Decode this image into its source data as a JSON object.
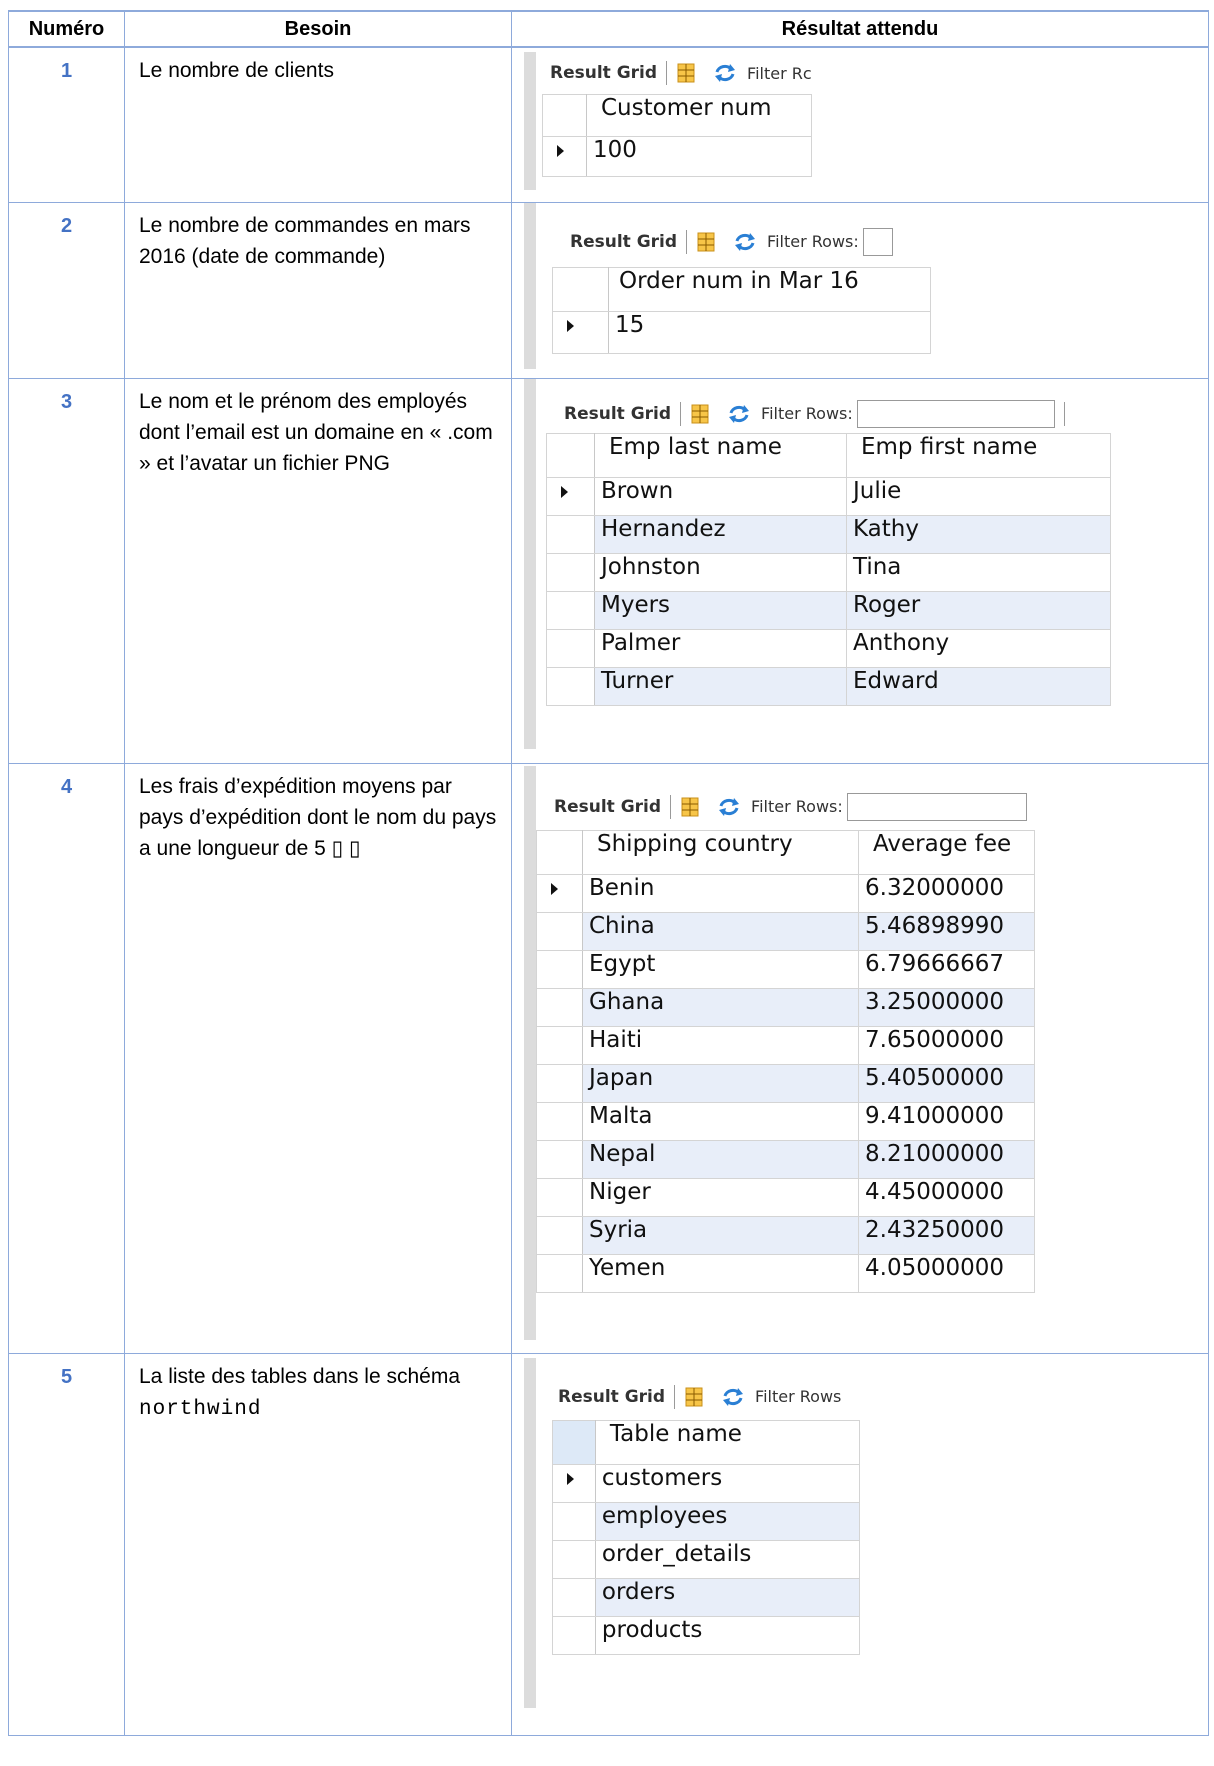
{
  "headers": {
    "num": "Numéro",
    "need": "Besoin",
    "result": "Résultat attendu"
  },
  "grid_toolbar": {
    "tab": "Result Grid",
    "filter_full": "Filter Rows:",
    "filter_cut_1": "Filter Rc",
    "filter_cut_5": "Filter Rows"
  },
  "rows": [
    {
      "num": "1",
      "need": "Le nombre de clients",
      "grid": {
        "columns": [
          "Customer num"
        ],
        "rows": [
          [
            "100"
          ]
        ]
      }
    },
    {
      "num": "2",
      "need": "Le nombre de commandes en mars 2016 (date de commande)",
      "grid": {
        "columns": [
          "Order num in Mar 16"
        ],
        "rows": [
          [
            "15"
          ]
        ]
      }
    },
    {
      "num": "3",
      "need": "Le nom et le prénom des employés dont l’email est un domaine en « .com » et l’avatar un fichier PNG",
      "grid": {
        "columns": [
          "Emp last name",
          "Emp first name"
        ],
        "rows": [
          [
            "Brown",
            "Julie"
          ],
          [
            "Hernandez",
            "Kathy"
          ],
          [
            "Johnston",
            "Tina"
          ],
          [
            "Myers",
            "Roger"
          ],
          [
            "Palmer",
            "Anthony"
          ],
          [
            "Turner",
            "Edward"
          ]
        ]
      }
    },
    {
      "num": "4",
      "need": "Les frais d’expédition moyens par pays d’expédition dont le nom du pays a une longueur de 5 ▯ ▯",
      "grid": {
        "columns": [
          "Shipping country",
          "Average fee"
        ],
        "rows": [
          [
            "Benin",
            "6.32000000"
          ],
          [
            "China",
            "5.46898990"
          ],
          [
            "Egypt",
            "6.79666667"
          ],
          [
            "Ghana",
            "3.25000000"
          ],
          [
            "Haiti",
            "7.65000000"
          ],
          [
            "Japan",
            "5.40500000"
          ],
          [
            "Malta",
            "9.41000000"
          ],
          [
            "Nepal",
            "8.21000000"
          ],
          [
            "Niger",
            "4.45000000"
          ],
          [
            "Syria",
            "2.43250000"
          ],
          [
            "Yemen",
            "4.05000000"
          ]
        ]
      }
    },
    {
      "num": "5",
      "need_text": "La liste des tables dans le schéma",
      "need_code": "northwind",
      "grid": {
        "columns": [
          "Table name"
        ],
        "rows": [
          [
            "customers"
          ],
          [
            "employees"
          ],
          [
            "order_details"
          ],
          [
            "orders"
          ],
          [
            "products"
          ]
        ]
      }
    }
  ]
}
